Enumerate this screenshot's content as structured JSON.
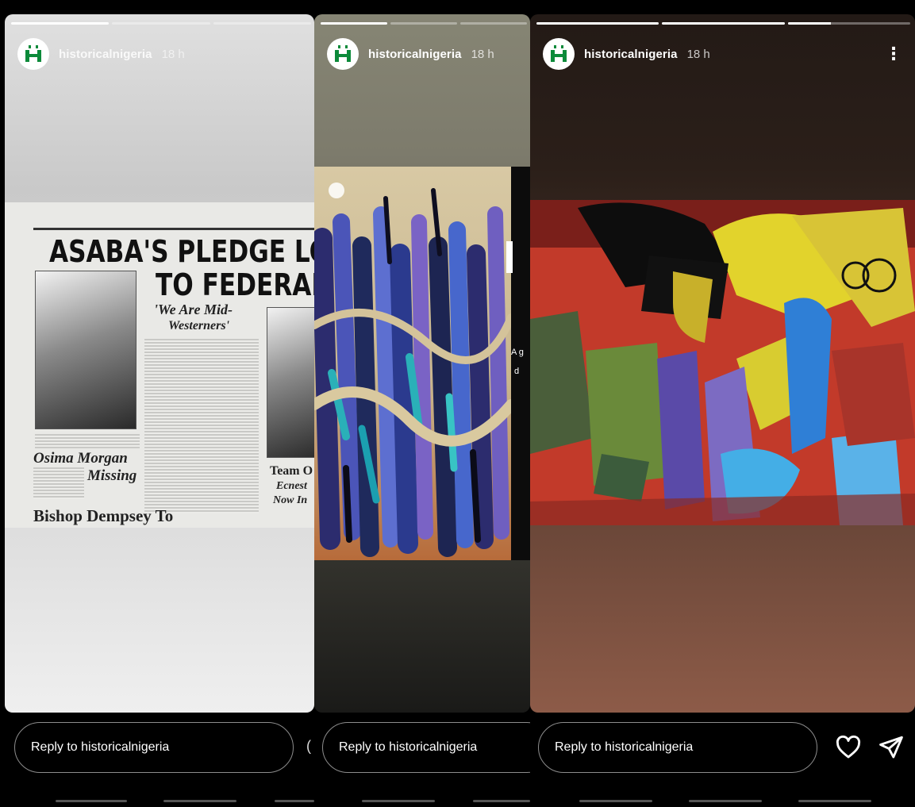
{
  "stories": [
    {
      "username": "historicalnigeria",
      "time": "18 h",
      "reply_placeholder": "Reply to historicalnigeria",
      "newspaper": {
        "headline_1": "ASABA'S  PLEDGE  LOYA",
        "headline_2": "TO  FEDERAL  G",
        "subhead_1": "'We Are Mid-",
        "subhead_2": "Westerners'",
        "story_1": "Osima Morgan",
        "story_2": "Missing",
        "story_3": "Bishop Dempsey To",
        "story_4": "Team O",
        "story_5": "Ecnest",
        "story_6": "Now In"
      }
    },
    {
      "username": "historicalnigeria",
      "time": "18 h",
      "reply_placeholder": "Reply to historicalnigeria",
      "overlay_text_1": "A g",
      "overlay_text_2": "d"
    },
    {
      "username": "historicalnigeria",
      "time": "18 h",
      "more_label": "⋮",
      "reply_placeholder": "Reply to historicalnigeria"
    }
  ],
  "avatar_letters": "HN",
  "colors": {
    "brand_green": "#0c8a3a",
    "story2_top": "#878677",
    "story3_top": "#2a1e18",
    "story3_bottom": "#8a5a46"
  }
}
